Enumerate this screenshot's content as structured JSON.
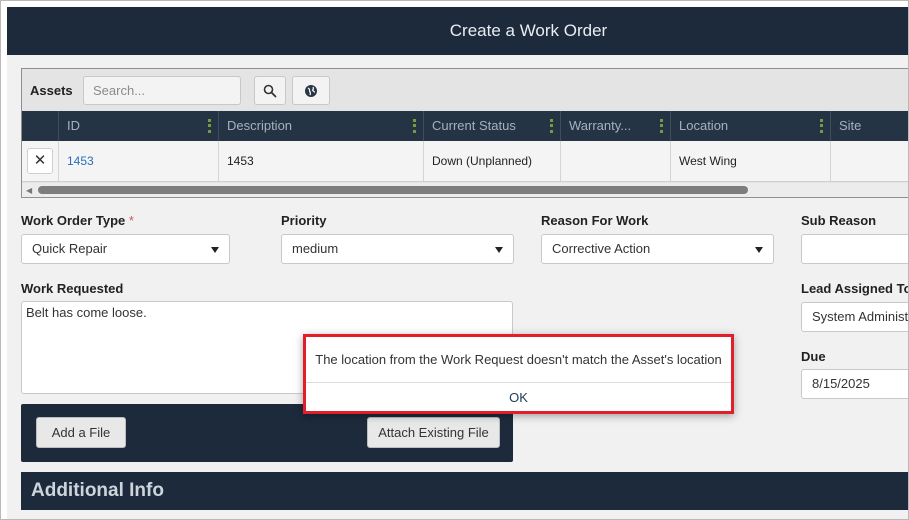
{
  "window": {
    "title": "Create a Work Order"
  },
  "assets": {
    "label": "Assets",
    "search_placeholder": "Search...",
    "columns": [
      "",
      "ID",
      "Description",
      "Current Status",
      "Warranty...",
      "Location",
      "Site"
    ],
    "row": {
      "id": "1453",
      "description": "1453",
      "current_status": "Down (Unplanned)",
      "warranty": "",
      "location": "West Wing",
      "site": ""
    }
  },
  "form": {
    "work_order_type": {
      "label": "Work Order Type",
      "required_mark": "*",
      "value": "Quick Repair"
    },
    "priority": {
      "label": "Priority",
      "value": "medium"
    },
    "reason_for_work": {
      "label": "Reason For Work",
      "value": "Corrective Action"
    },
    "sub_reason": {
      "label": "Sub Reason",
      "value": ""
    },
    "work_requested": {
      "label": "Work Requested",
      "value": "Belt has come loose."
    },
    "lead_assigned_to": {
      "label": "Lead Assigned To",
      "value": "System Administrator"
    },
    "due": {
      "label": "Due",
      "value": "8/15/2025"
    }
  },
  "files": {
    "add_label": "Add a File",
    "attach_label": "Attach Existing File"
  },
  "additional_info": {
    "title": "Additional Info"
  },
  "dialog": {
    "message": "The location from the Work Request doesn't match the Asset's location",
    "ok_label": "OK",
    "border_color": "#e01f2a"
  },
  "colors": {
    "header_bg": "#1c2a3b",
    "grid_header_bg": "#253445",
    "link": "#2a6ebb"
  }
}
